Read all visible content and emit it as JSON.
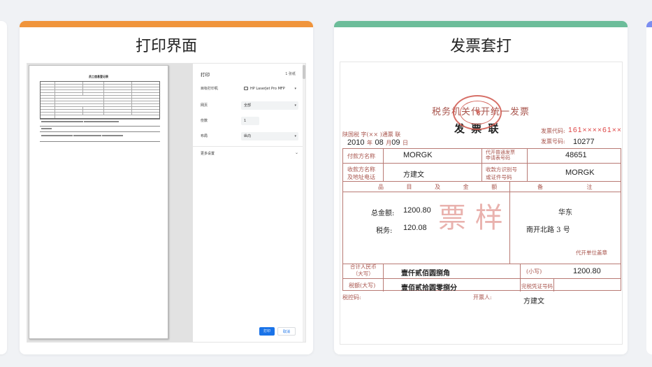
{
  "cards": [
    {
      "title": "打印界面",
      "accent": "#f0943b"
    },
    {
      "title": "发票套打",
      "accent": "#6cbd9a"
    }
  ],
  "print_dialog": {
    "header": "打印",
    "page_count": "1 张纸",
    "fields": [
      {
        "label": "目标打印机",
        "value": "HP LaserJet Pro MFP",
        "type": "select"
      },
      {
        "label": "网页",
        "value": "全部",
        "type": "select"
      },
      {
        "label": "份数",
        "value": "1",
        "type": "input"
      },
      {
        "label": "布局",
        "value": "纵向",
        "type": "select"
      }
    ],
    "more_settings": "更多设置",
    "print_button": "打印",
    "cancel_button": "取消",
    "preview_doc_title": "员工信息登记表"
  },
  "invoice": {
    "header_title": "税务机关代开统一发票",
    "copy_label": "发 票 联",
    "issuer_line": "陕国税  字(×× )通票  联",
    "date_year": "2010",
    "date_month": "08",
    "date_day": "09",
    "date_units": [
      "年",
      "月",
      "日"
    ],
    "code_label": "发票代码:",
    "code_value": "161××××61×××",
    "number_label": "发票号码:",
    "number_value": "10277",
    "payer_name_label": "付款方名称",
    "payer_name_value": "MORGK",
    "app_no_label": "代开普通发票\n申请表号码",
    "app_no_value": "48651",
    "payee_label": "收款方名称\n及地址电话",
    "payee_value": "方建文",
    "payee_id_label": "收款方识别号\n或证件号码",
    "payee_id_value": "MORGK",
    "item_header": [
      "品",
      "目",
      "及",
      "金",
      "额"
    ],
    "remark_header": [
      "备",
      "注"
    ],
    "total_label": "总金额:",
    "total_value": "1200.80",
    "tax_label": "税务:",
    "tax_value": "120.08",
    "remark_1": "华东",
    "remark_2": "南开北路 3 号",
    "agent_seal": "代开单位盖章",
    "sum_cn_label": "合计人民币\n（大写）",
    "sum_cn_value": "壹仟贰佰圆捌角",
    "sum_small_label": "(小写)",
    "sum_small_value": "1200.80",
    "tax_cn_label": "税额(大写)",
    "tax_cn_value": "壹佰贰拾圆零捌分",
    "tax_voucher_label": "完税凭证号码",
    "control_label": "税控码:",
    "issuer_label": "开票人:",
    "issuer_value": "方建文",
    "watermark": "票 样",
    "stamp_text": "代开税务机关 陕西××"
  },
  "colors": {
    "invoice_frame": "#a8554d",
    "stamp": "#d0574d",
    "print_button": "#1a73e8"
  }
}
